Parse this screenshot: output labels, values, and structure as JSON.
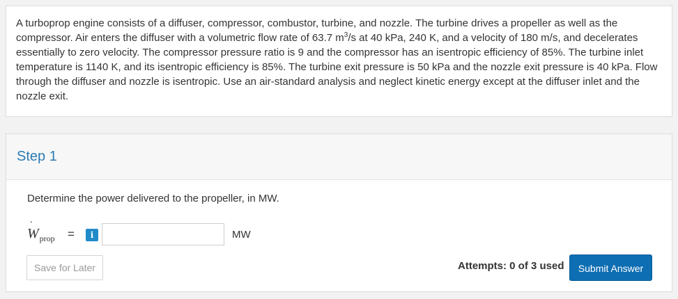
{
  "problem": {
    "text_before_sup": "A turboprop engine consists of a diffuser, compressor, combustor, turbine, and nozzle. The turbine drives a propeller as well as the compressor. Air enters the diffuser with a volumetric flow rate of 63.7 m",
    "sup": "3",
    "text_after_sup": "/s at 40 kPa, 240 K, and a velocity of 180 m/s, and decelerates essentially to zero velocity. The compressor pressure ratio is 9 and the compressor has an isentropic efficiency of 85%. The turbine inlet temperature is 1140 K, and its isentropic efficiency is 85%. The turbine exit pressure is 50 kPa and the nozzle exit pressure is 40 kPa. Flow through the diffuser and nozzle is isentropic. Use an air-standard analysis and neglect kinetic energy except at the diffuser inlet and the nozzle exit."
  },
  "step": {
    "title": "Step 1",
    "question": "Determine the power delivered to the propeller, in MW.",
    "variable": "W",
    "variable_dot": "˙",
    "variable_sub": "prop",
    "equals": "=",
    "info_icon": "i",
    "input_value": "",
    "unit": "MW",
    "save_label": "Save for Later",
    "attempts": "Attempts: 0 of 3 used",
    "submit_label": "Submit Answer"
  },
  "colors": {
    "accent": "#2b7bb3",
    "info_button": "#1f8bc8",
    "submit_button": "#0d6eb3"
  }
}
